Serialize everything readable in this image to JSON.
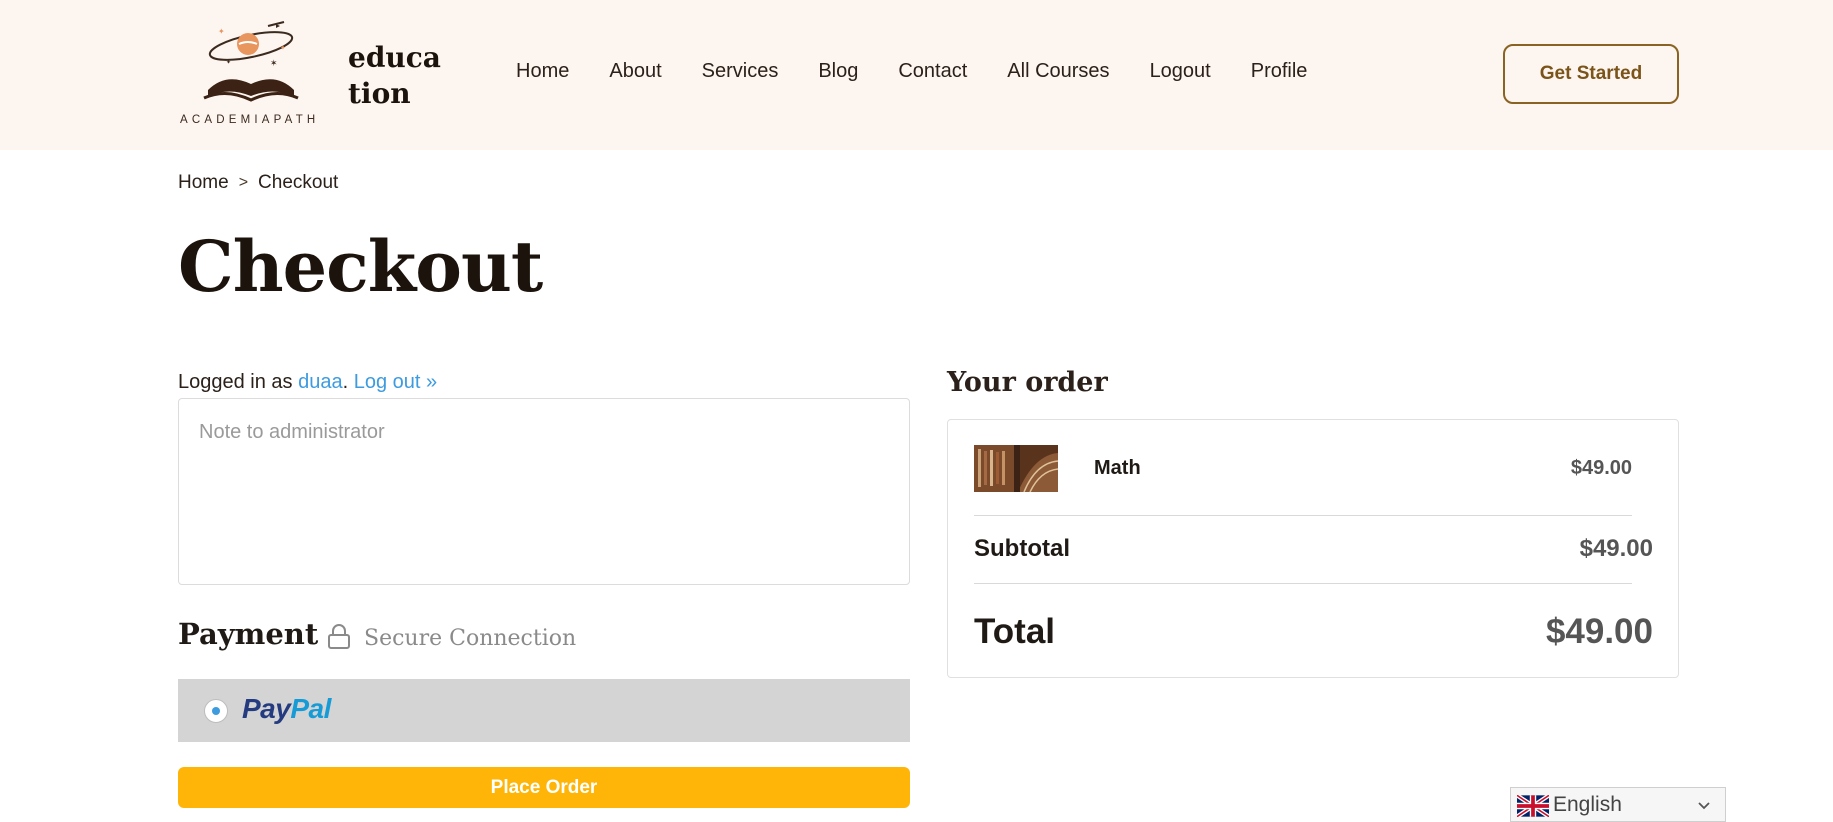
{
  "header": {
    "logo_text": "ACADEMIAPATH",
    "site_name": "educa tion",
    "nav": [
      "Home",
      "About",
      "Services",
      "Blog",
      "Contact",
      "All Courses",
      "Logout",
      "Profile"
    ],
    "cta_label": "Get Started"
  },
  "breadcrumb": {
    "home": "Home",
    "separator": ">",
    "current": "Checkout"
  },
  "page_title": "Checkout",
  "account": {
    "prefix": "Logged in as ",
    "username": "duaa",
    "dot": ".",
    "logout_label": "Log out »"
  },
  "note": {
    "placeholder": "Note to administrator",
    "value": ""
  },
  "payment": {
    "title": "Payment",
    "secure_label": "Secure Connection",
    "method": {
      "brand_part1": "Pay",
      "brand_part2": "Pal",
      "selected": true
    }
  },
  "place_order_label": "Place Order",
  "order": {
    "title": "Your order",
    "items": [
      {
        "name": "Math",
        "price": "$49.00"
      }
    ],
    "subtotal_label": "Subtotal",
    "subtotal_value": "$49.00",
    "total_label": "Total",
    "total_value": "$49.00"
  },
  "language": {
    "label": "English"
  },
  "colors": {
    "header_bg": "#fdf6f0",
    "accent_brown": "#8a6222",
    "link_blue": "#3d9be0",
    "place_order_bg": "#ffb507",
    "paypal_bg": "#d4d4d4"
  }
}
